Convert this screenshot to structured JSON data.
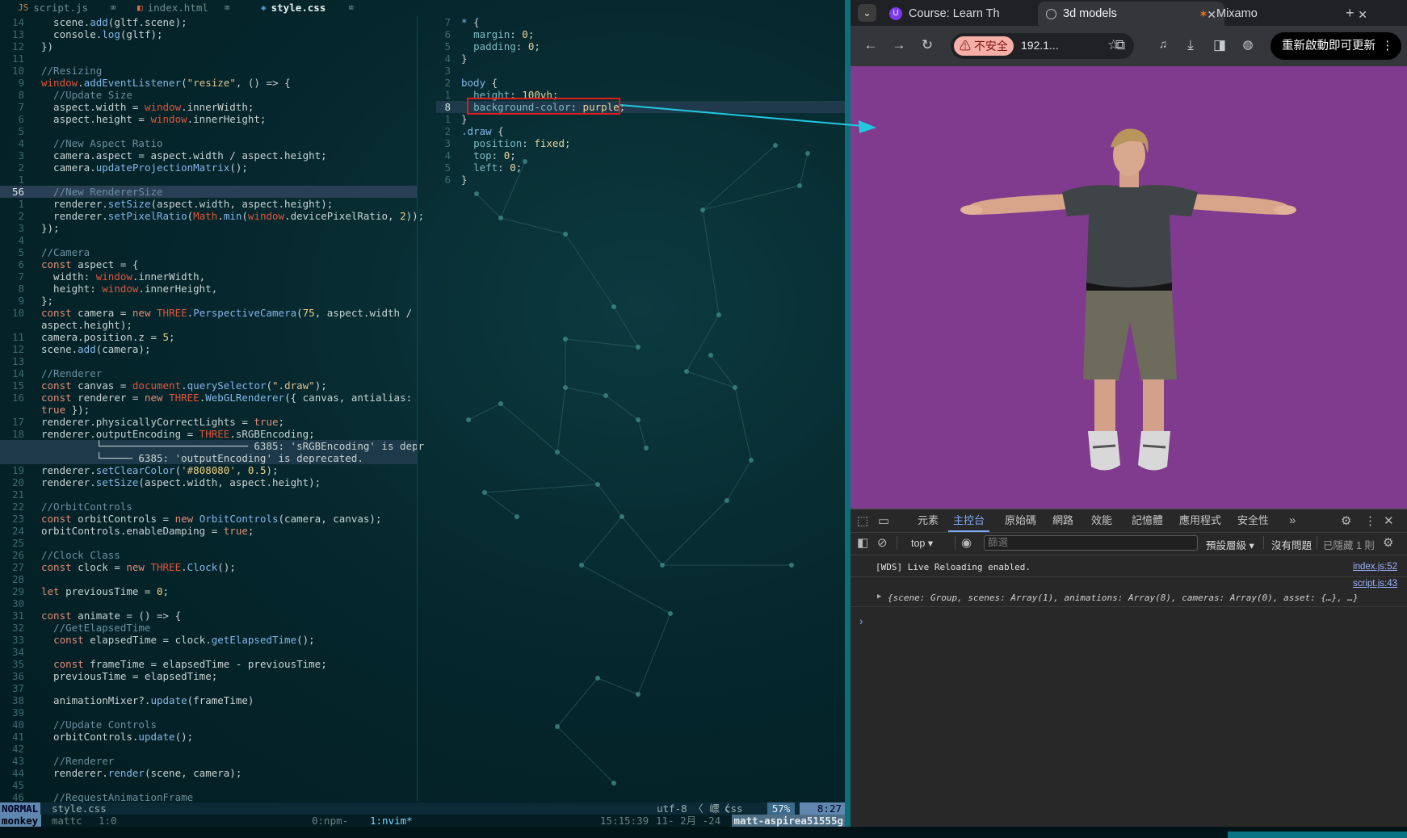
{
  "editor": {
    "tabs": [
      {
        "icon": "js",
        "name": "script.js",
        "close": "⌧"
      },
      {
        "icon": "html",
        "name": "index.html",
        "close": "⌧"
      },
      {
        "icon": "css",
        "name": "style.css",
        "close": "⌧"
      }
    ],
    "left_lines": [
      {
        "n": "14",
        "t": "  scene.add(gltf.scene);"
      },
      {
        "n": "13",
        "t": "  console.log(gltf);"
      },
      {
        "n": "12",
        "t": "})"
      },
      {
        "n": "11",
        "t": ""
      },
      {
        "n": "10",
        "t": "//Resizing"
      },
      {
        "n": "9",
        "t": "window.addEventListener(\"resize\", () => {"
      },
      {
        "n": "8",
        "t": "  //Update Size"
      },
      {
        "n": "7",
        "t": "  aspect.width = window.innerWidth;"
      },
      {
        "n": "6",
        "t": "  aspect.height = window.innerHeight;"
      },
      {
        "n": "5",
        "t": ""
      },
      {
        "n": "4",
        "t": "  //New Aspect Ratio"
      },
      {
        "n": "3",
        "t": "  camera.aspect = aspect.width / aspect.height;"
      },
      {
        "n": "2",
        "t": "  camera.updateProjectionMatrix();"
      },
      {
        "n": "1",
        "t": ""
      },
      {
        "n": "56",
        "t": "  //New RendererSize"
      },
      {
        "n": "1",
        "t": "  renderer.setSize(aspect.width, aspect.height);"
      },
      {
        "n": "2",
        "t": "  renderer.setPixelRatio(Math.min(window.devicePixelRatio, 2));"
      },
      {
        "n": "3",
        "t": "});"
      },
      {
        "n": "4",
        "t": ""
      },
      {
        "n": "5",
        "t": "//Camera"
      },
      {
        "n": "6",
        "t": "const aspect = {"
      },
      {
        "n": "7",
        "t": "  width: window.innerWidth,"
      },
      {
        "n": "8",
        "t": "  height: window.innerHeight,"
      },
      {
        "n": "9",
        "t": "};"
      },
      {
        "n": "10",
        "t": "const camera = new THREE.PerspectiveCamera(75, aspect.width /"
      },
      {
        "n": "",
        "t": "aspect.height);"
      },
      {
        "n": "11",
        "t": "camera.position.z = 5;"
      },
      {
        "n": "12",
        "t": "scene.add(camera);"
      },
      {
        "n": "13",
        "t": ""
      },
      {
        "n": "14",
        "t": "//Renderer"
      },
      {
        "n": "15",
        "t": "const canvas = document.querySelector(\".draw\");"
      },
      {
        "n": "16",
        "t": "const renderer = new THREE.WebGLRenderer({ canvas, antialias:"
      },
      {
        "n": "",
        "t": "true });"
      },
      {
        "n": "17",
        "t": "renderer.physicallyCorrectLights = true;"
      },
      {
        "n": "18",
        "t": "renderer.outputEncoding = THREE.sRGBEncoding;"
      },
      {
        "n": "",
        "t": "         └──────────────────────── 6385: 'sRGBEncoding' is depr"
      },
      {
        "n": "",
        "t": "         └───── 6385: 'outputEncoding' is deprecated."
      },
      {
        "n": "19",
        "t": "renderer.setClearColor('#808080', 0.5);"
      },
      {
        "n": "20",
        "t": "renderer.setSize(aspect.width, aspect.height);"
      },
      {
        "n": "21",
        "t": ""
      },
      {
        "n": "22",
        "t": "//OrbitControls"
      },
      {
        "n": "23",
        "t": "const orbitControls = new OrbitControls(camera, canvas);"
      },
      {
        "n": "24",
        "t": "orbitControls.enableDamping = true;"
      },
      {
        "n": "25",
        "t": ""
      },
      {
        "n": "26",
        "t": "//Clock Class"
      },
      {
        "n": "27",
        "t": "const clock = new THREE.Clock();"
      },
      {
        "n": "28",
        "t": ""
      },
      {
        "n": "29",
        "t": "let previousTime = 0;"
      },
      {
        "n": "30",
        "t": ""
      },
      {
        "n": "31",
        "t": "const animate = () => {"
      },
      {
        "n": "32",
        "t": "  //GetElapsedTime"
      },
      {
        "n": "33",
        "t": "  const elapsedTime = clock.getElapsedTime();"
      },
      {
        "n": "34",
        "t": ""
      },
      {
        "n": "35",
        "t": "  const frameTime = elapsedTime - previousTime;"
      },
      {
        "n": "36",
        "t": "  previousTime = elapsedTime;"
      },
      {
        "n": "37",
        "t": ""
      },
      {
        "n": "38",
        "t": "  animationMixer?.update(frameTime)"
      },
      {
        "n": "39",
        "t": ""
      },
      {
        "n": "40",
        "t": "  //Update Controls"
      },
      {
        "n": "41",
        "t": "  orbitControls.update();"
      },
      {
        "n": "42",
        "t": ""
      },
      {
        "n": "43",
        "t": "  //Renderer"
      },
      {
        "n": "44",
        "t": "  renderer.render(scene, camera);"
      },
      {
        "n": "45",
        "t": ""
      },
      {
        "n": "46",
        "t": "  //RequestAnimationFrame"
      }
    ],
    "right_lines": [
      {
        "n": "7",
        "t": "* {"
      },
      {
        "n": "6",
        "t": "  margin: 0;"
      },
      {
        "n": "5",
        "t": "  padding: 0;"
      },
      {
        "n": "4",
        "t": "}"
      },
      {
        "n": "3",
        "t": ""
      },
      {
        "n": "2",
        "t": "body {"
      },
      {
        "n": "1",
        "t": "  height: 100vh;"
      },
      {
        "n": "8",
        "t": "  background-color: purple;"
      },
      {
        "n": "1",
        "t": "}"
      },
      {
        "n": "2",
        "t": ".draw {"
      },
      {
        "n": "3",
        "t": "  position: fixed;"
      },
      {
        "n": "4",
        "t": "  top: 0;"
      },
      {
        "n": "5",
        "t": "  left: 0;"
      },
      {
        "n": "6",
        "t": "}"
      }
    ],
    "statusline": {
      "mode": "NORMAL",
      "file": "style.css",
      "encoding": "utf-8 〈 㟽〈",
      "filetype": "css",
      "percent": "57%",
      "position": "8:27"
    },
    "tmux": {
      "session": "monkey",
      "user": "mattc",
      "pane": "1:0",
      "window0": "0:npm-",
      "window1": "1:nvim*",
      "time": "15:15:39",
      "date": "11- 2月 -24",
      "host": "matt-aspirea51555g"
    }
  },
  "browser": {
    "tabs": [
      {
        "title": "Course: Learn Th",
        "favicon": "course-icon"
      },
      {
        "title": "3d models",
        "favicon": "globe-icon"
      },
      {
        "title": "Mixamo",
        "favicon": "mixamo-icon"
      }
    ],
    "insecure_label": "⚠ 不安全",
    "url": "192.1...",
    "update_button": "重新啟動即可更新",
    "page_background": "#813b8e",
    "devtools": {
      "tabs": [
        "元素",
        "主控台",
        "原始碼",
        "網路",
        "效能",
        "記憶體",
        "應用程式",
        "安全性"
      ],
      "context": "top",
      "filter_placeholder": "篩選",
      "levels": "預設層級",
      "issues": "沒有問題",
      "hidden": "已隱藏 1 則",
      "messages": [
        {
          "text": "[WDS] Live Reloading enabled.",
          "source": "index.js:52"
        },
        {
          "text": "{scene: Group, scenes: Array(1), animations: Array(8), cameras: Array(0), asset: {…}, …}",
          "source": "script.js:43"
        }
      ]
    }
  }
}
